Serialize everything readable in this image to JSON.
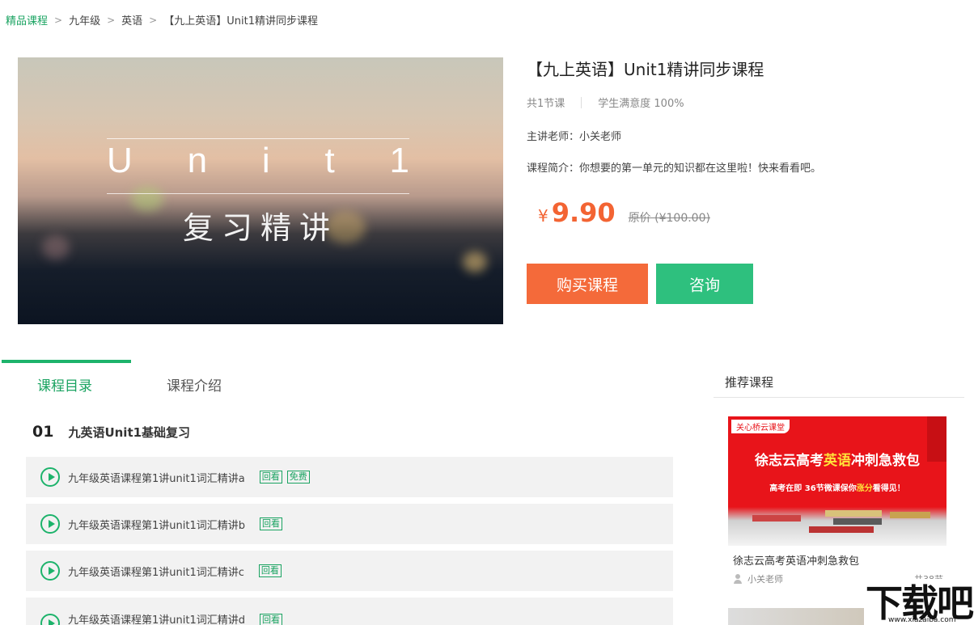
{
  "breadcrumb": {
    "items": [
      "精品课程",
      "九年级",
      "英语"
    ],
    "separator": ">",
    "current": "【九上英语】Unit1精讲同步课程"
  },
  "cover": {
    "letters": [
      "U",
      "n",
      "i",
      "t",
      "1"
    ],
    "subtitle": "复习精讲"
  },
  "course": {
    "title": "【九上英语】Unit1精讲同步课程",
    "lesson_count": "共1节课",
    "satisfaction": "学生满意度 100%",
    "teacher": "主讲老师：小关老师",
    "intro": "课程简介：你想要的第一单元的知识都在这里啦！快来看看吧。",
    "price_symbol": "¥",
    "price": "9.90",
    "original_price": "原价 (¥100.00)",
    "buy_label": "购买课程",
    "consult_label": "咨询"
  },
  "tabs": {
    "catalog": "课程目录",
    "introduction": "课程介绍"
  },
  "chapter": {
    "number": "01",
    "title": "九英语Unit1基础复习"
  },
  "lessons": [
    {
      "title": "九年级英语课程第1讲unit1词汇精讲a",
      "tags": [
        "回看",
        "免费"
      ]
    },
    {
      "title": "九年级英语课程第1讲unit1词汇精讲b",
      "tags": [
        "回看"
      ]
    },
    {
      "title": "九年级英语课程第1讲unit1词汇精讲c",
      "tags": [
        "回看"
      ]
    },
    {
      "title": "九年级英语课程第1讲unit1词汇精讲d",
      "tags": [
        "回看"
      ]
    }
  ],
  "recommend": {
    "heading": "推荐课程",
    "card": {
      "badge": "关心桥云课堂",
      "banner_before": "徐志云高考",
      "banner_highlight": "英语",
      "banner_after": "冲刺急救包",
      "sub_before": "高考在即  36节微课保你",
      "sub_highlight": "涨分",
      "sub_after": "看得见！",
      "title": "徐志云高考英语冲刺急救包",
      "teacher": "小关老师",
      "count": "共38节"
    }
  },
  "watermark": {
    "text": "下载吧",
    "url": "www.xiazaiba.com"
  }
}
